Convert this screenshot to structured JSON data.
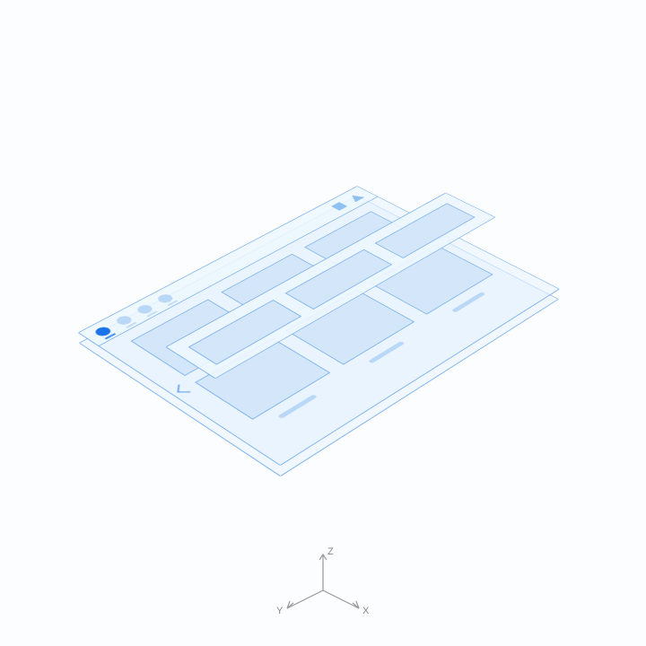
{
  "diagram": {
    "concept": "isometric-layered-ui-wireframe",
    "layers": [
      "base-plane",
      "app-window",
      "floating-toolbar"
    ]
  },
  "topbar": {
    "avatars": [
      "active",
      "",
      "",
      ""
    ],
    "shape_tools": [
      "square",
      "triangle"
    ]
  },
  "content": {
    "card_count": 6,
    "has_prev": true,
    "has_next": true
  },
  "panel": {
    "slot_count": 3
  },
  "axes": {
    "x": "X",
    "y": "Y",
    "z": "Z"
  }
}
